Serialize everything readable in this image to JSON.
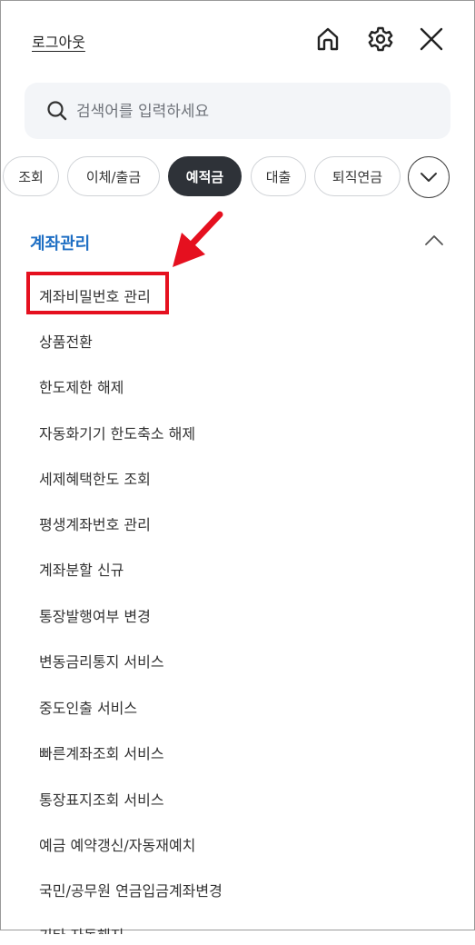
{
  "header": {
    "logout_label": "로그아웃",
    "icons": [
      "home-icon",
      "gear-icon",
      "close-icon"
    ]
  },
  "search": {
    "placeholder": "검색어를 입력하세요"
  },
  "tabs": [
    {
      "label": "조회",
      "active": false
    },
    {
      "label": "이체/출금",
      "active": false
    },
    {
      "label": "예적금",
      "active": true
    },
    {
      "label": "대출",
      "active": false
    },
    {
      "label": "퇴직연금",
      "active": false
    }
  ],
  "section": {
    "title": "계좌관리",
    "expanded": true
  },
  "menu_items": [
    "계좌비밀번호 관리",
    "상품전환",
    "한도제한 해제",
    "자동화기기 한도축소 해제",
    "세제혜택한도 조회",
    "평생계좌번호 관리",
    "계좌분할 신규",
    "통장발행여부 변경",
    "변동금리통지 서비스",
    "중도인출 서비스",
    "빠른계좌조회 서비스",
    "통장표지조회 서비스",
    "예금 예약갱신/자동재예치",
    "국민/공무원 연금입금계좌변경",
    "기타 자동해지"
  ],
  "colors": {
    "accent": "#1f6fc4",
    "active_tab": "#2e3238",
    "annotation": "#e5101f"
  }
}
